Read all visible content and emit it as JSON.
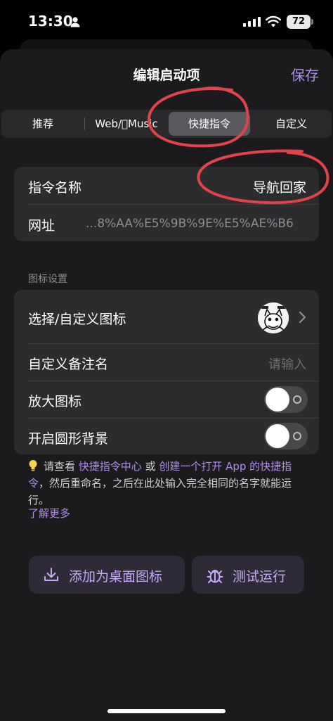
{
  "status": {
    "time": "13:30",
    "battery": "72"
  },
  "header": {
    "title": "编辑启动项",
    "save_label": "保存"
  },
  "tabs": [
    {
      "label": "推荐"
    },
    {
      "label": "Web/Music"
    },
    {
      "label": "快捷指令",
      "selected": true
    },
    {
      "label": "自定义"
    }
  ],
  "shortcut": {
    "name_label": "指令名称",
    "name_value": "导航回家",
    "url_label": "网址",
    "url_value": "...8%AA%E5%9B%9E%E5%AE%B6"
  },
  "icon_settings": {
    "header": "图标设置",
    "choose_label": "选择/自定义图标",
    "remark_label": "自定义备注名",
    "remark_placeholder": "请输入",
    "enlarge_label": "放大图标",
    "enlarge_on": false,
    "circle_bg_label": "开启圆形背景",
    "circle_bg_on": false
  },
  "note": {
    "prefix": "请查看 ",
    "link1": "快捷指令中心",
    "middle": " 或 ",
    "link2": "创建一个打开 App 的快捷指令",
    "suffix": "，然后重命名，之后在此处输入完全相同的名字就能运行。",
    "learn_more": "了解更多"
  },
  "buttons": {
    "add_to_home": "添加为桌面图标",
    "test_run": "测试运行"
  },
  "colors": {
    "accent": "#b48cf0",
    "annotation": "#e0434a",
    "background": "#1b1b1d",
    "card": "#2c2c2e"
  }
}
